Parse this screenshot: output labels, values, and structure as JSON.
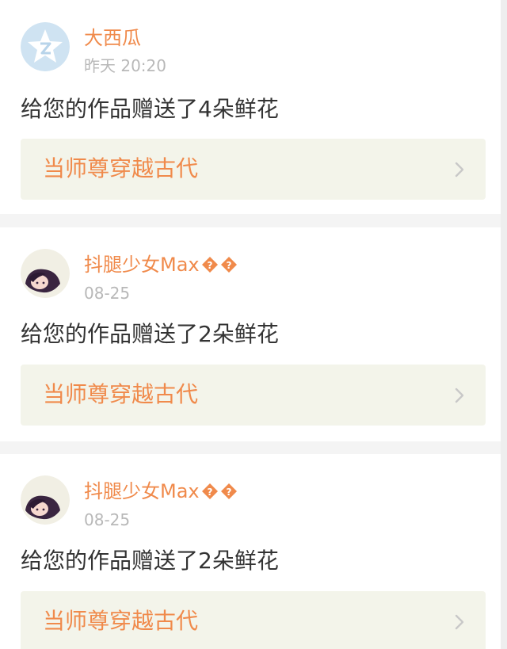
{
  "colors": {
    "accent": "#f08a4b",
    "username_unknown_char": "#f08a4b",
    "timestamp": "#b8b8b8",
    "body_text": "#333333",
    "link_bg": "#f3f4ea",
    "chevron": "#c8c8c8",
    "avatar_default_bg": "#cfe3f2"
  },
  "notifications": [
    {
      "avatar": "default-star-avatar-icon",
      "username": "大西瓜",
      "timestamp": "昨天 20:20",
      "message": "给您的作品赠送了4朵鲜花",
      "work_title": "当师尊穿越古代",
      "chevron": "chevron-right-icon"
    },
    {
      "avatar": "girl-avatar-icon",
      "username": "抖腿少女Max",
      "username_suffix_glyphs": "unknown-char-icon x2",
      "timestamp": "08-25",
      "message": "给您的作品赠送了2朵鲜花",
      "work_title": "当师尊穿越古代",
      "chevron": "chevron-right-icon"
    },
    {
      "avatar": "girl-avatar-icon",
      "username": "抖腿少女Max",
      "username_suffix_glyphs": "unknown-char-icon x2",
      "timestamp": "08-25",
      "message": "给您的作品赠送了2朵鲜花",
      "work_title": "当师尊穿越古代",
      "chevron": "chevron-right-icon"
    }
  ]
}
